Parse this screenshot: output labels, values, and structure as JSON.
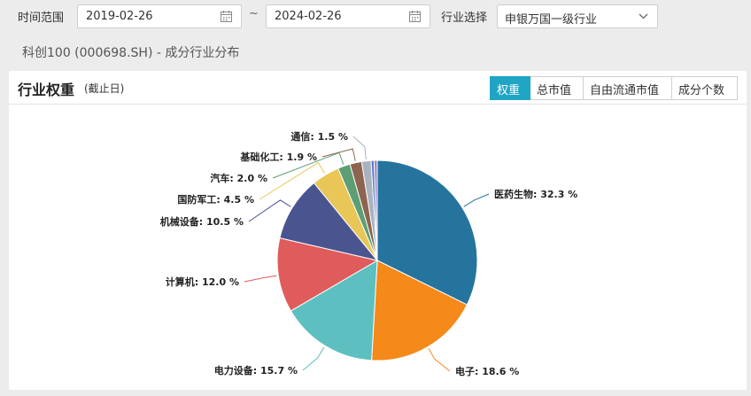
{
  "filters": {
    "time_range_label": "时间范围",
    "start_date": "2019-02-26",
    "separator": "~",
    "end_date": "2024-02-26",
    "industry_label": "行业选择",
    "industry_value": "申银万国一级行业"
  },
  "subtitle": "科创100 (000698.SH) - 成分行业分布",
  "panel": {
    "title": "行业权重",
    "note": "(截止日)",
    "tabs": [
      "权重",
      "总市值",
      "自由流通市值",
      "成分个数"
    ],
    "active_tab": "权重"
  },
  "chart_data": {
    "type": "pie",
    "title": "",
    "slices": [
      {
        "label": "医药生物",
        "value": 32.3,
        "display": "医药生物: 32.3 %",
        "color": "#25749e"
      },
      {
        "label": "电子",
        "value": 18.6,
        "display": "电子: 18.6 %",
        "color": "#f5891a"
      },
      {
        "label": "电力设备",
        "value": 15.7,
        "display": "电力设备: 15.7 %",
        "color": "#5dbfbf"
      },
      {
        "label": "计算机",
        "value": 12.0,
        "display": "计算机: 12.0 %",
        "color": "#e05b5b"
      },
      {
        "label": "机械设备",
        "value": 10.5,
        "display": "机械设备: 10.5 %",
        "color": "#4a5590"
      },
      {
        "label": "国防军工",
        "value": 4.5,
        "display": "国防军工: 4.5 %",
        "color": "#e8c658"
      },
      {
        "label": "汽车",
        "value": 2.0,
        "display": "汽车: 2.0 %",
        "color": "#5d9e75"
      },
      {
        "label": "基础化工",
        "value": 1.9,
        "display": "基础化工: 1.9 %",
        "color": "#8c6450"
      },
      {
        "label": "通信",
        "value": 1.5,
        "display": "通信: 1.5 %",
        "color": "#a9b2bf"
      },
      {
        "label": "",
        "value": 0.5,
        "display": "",
        "color": "#5f7fc0"
      },
      {
        "label": "",
        "value": 0.5,
        "display": "",
        "color": "#9a85c8"
      }
    ]
  }
}
